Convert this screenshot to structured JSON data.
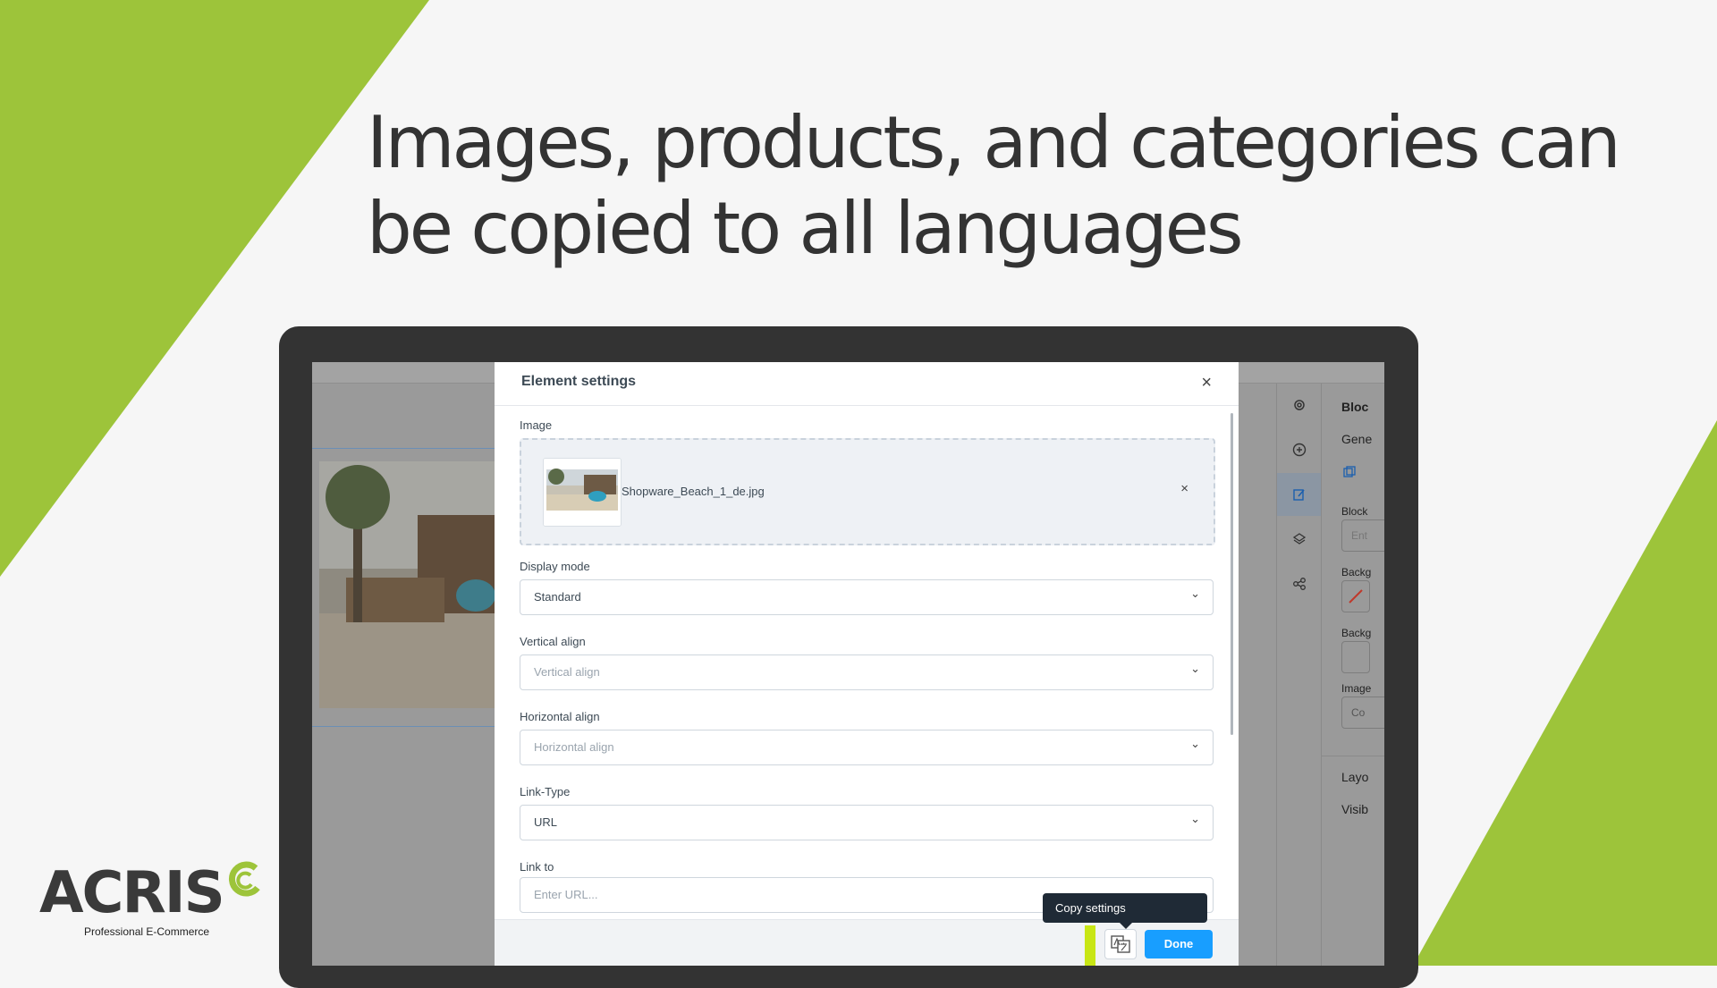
{
  "headline": "Images, products, and categories can be copied to all languages",
  "colors": {
    "accent_green": "#9dc43a",
    "button_blue": "#189eff",
    "frame": "#333333"
  },
  "modal": {
    "title": "Element settings",
    "close_icon": "close-icon",
    "image": {
      "label": "Image",
      "file_name": "Shopware_Beach_1_de.jpg"
    },
    "display_mode": {
      "label": "Display mode",
      "value": "Standard"
    },
    "vertical_align": {
      "label": "Vertical align",
      "placeholder": "Vertical align"
    },
    "horizontal_align": {
      "label": "Horizontal align",
      "placeholder": "Horizontal align"
    },
    "link_type": {
      "label": "Link-Type",
      "value": "URL"
    },
    "link_to": {
      "label": "Link to",
      "placeholder": "Enter URL..."
    },
    "footer": {
      "tooltip": "Copy settings",
      "translate_icon": "translate-icon",
      "done_label": "Done"
    }
  },
  "sidebar_panel": {
    "title": "Bloc",
    "tab": "Gene",
    "fields": [
      "Block",
      "Backg",
      "Backg",
      "Image"
    ],
    "select_value": "Co",
    "input_placeholder": "Ent",
    "sections": [
      "Layo",
      "Visib"
    ]
  },
  "logo": {
    "wordmark": "ACRIS",
    "tagline": "Professional E-Commerce"
  }
}
